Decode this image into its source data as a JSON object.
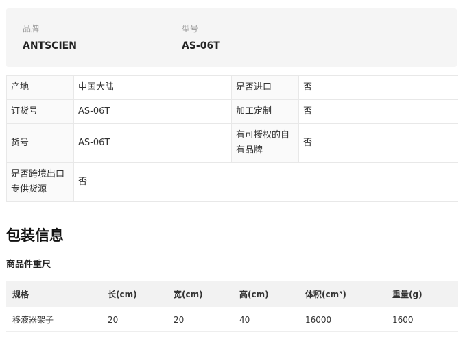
{
  "brand_info": {
    "brand_label": "品牌",
    "brand_value": "ANTSCIEN",
    "model_label": "型号",
    "model_value": "AS-06T"
  },
  "attributes": {
    "origin_label": "产地",
    "origin_value": "中国大陆",
    "imported_label": "是否进口",
    "imported_value": "否",
    "order_no_label": "订货号",
    "order_no_value": "AS-06T",
    "custom_label": "加工定制",
    "custom_value": "否",
    "item_no_label": "货号",
    "item_no_value": "AS-06T",
    "authorized_label": "有可授权的自有品牌",
    "authorized_value": "否",
    "cross_border_label": "是否跨境出口专供货源",
    "cross_border_value": "否"
  },
  "packaging": {
    "section_title": "包装信息",
    "subsection_title": "商品件重尺",
    "headers": [
      "规格",
      "长(cm)",
      "宽(cm)",
      "高(cm)",
      "体积(cm³)",
      "重量(g)"
    ],
    "rows": [
      [
        "移液器架子",
        "20",
        "20",
        "40",
        "16000",
        "1600"
      ]
    ]
  }
}
